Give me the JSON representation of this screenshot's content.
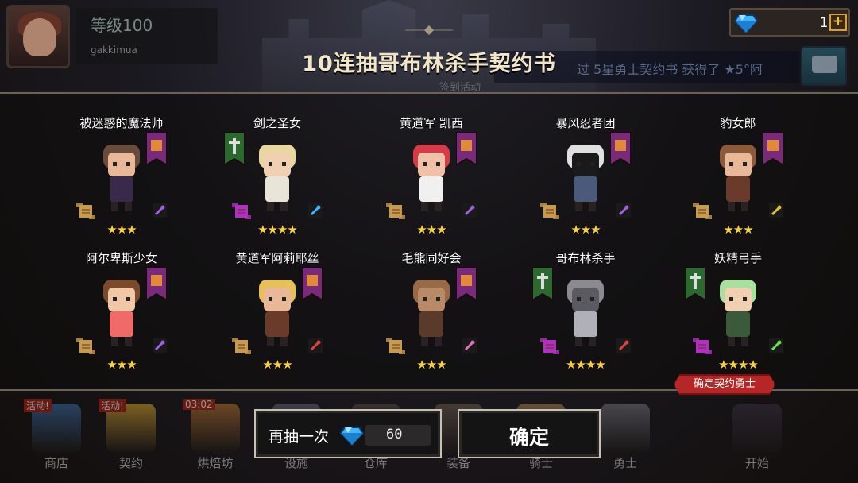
{
  "player": {
    "level": "等级100",
    "username": "gakkimua"
  },
  "currency": {
    "gems": "1"
  },
  "ticker": {
    "text": "过 5星勇士契约书 获得了 ★5°阿"
  },
  "modal": {
    "title": "10连抽哥布林杀手契约书",
    "sub_label": "签到活动",
    "redraw_label": "再抽一次",
    "redraw_cost": "60",
    "confirm_label": "确定",
    "confirm_tag": "确定契约勇士"
  },
  "heroes": [
    {
      "name": "被迷惑的魔法师",
      "stars": "★★★",
      "star_count": 3,
      "banner": "purple",
      "weapon": "staff-icon"
    },
    {
      "name": "剑之圣女",
      "stars": "★★★★",
      "star_count": 4,
      "banner": "green",
      "weapon": "hammer-icon"
    },
    {
      "name": "黄道军 凯西",
      "stars": "★★★",
      "star_count": 3,
      "banner": "purple",
      "weapon": "staff-icon"
    },
    {
      "name": "暴风忍者团",
      "stars": "★★★",
      "star_count": 3,
      "banner": "purple",
      "weapon": "staff-icon"
    },
    {
      "name": "豹女郎",
      "stars": "★★★",
      "star_count": 3,
      "banner": "purple",
      "weapon": "sword-icon"
    },
    {
      "name": "阿尔卑斯少女",
      "stars": "★★★",
      "star_count": 3,
      "banner": "purple",
      "weapon": "staff-icon"
    },
    {
      "name": "黄道军阿莉耶丝",
      "stars": "★★★",
      "star_count": 3,
      "banner": "purple",
      "weapon": "dagger-icon"
    },
    {
      "name": "毛熊同好会",
      "stars": "★★★",
      "star_count": 3,
      "banner": "purple",
      "weapon": "amulet-icon"
    },
    {
      "name": "哥布林杀手",
      "stars": "★★★★",
      "star_count": 4,
      "banner": "green",
      "weapon": "dagger-icon"
    },
    {
      "name": "妖精弓手",
      "stars": "★★★★",
      "star_count": 4,
      "banner": "green",
      "weapon": "bow-icon"
    }
  ],
  "nav": [
    {
      "label": "商店",
      "badge": "活动!"
    },
    {
      "label": "契约",
      "badge": "活动!"
    },
    {
      "label": "烘焙坊",
      "badge": "03:02"
    },
    {
      "label": "设施",
      "badge": ""
    },
    {
      "label": "仓库",
      "badge": ""
    },
    {
      "label": "装备",
      "badge": ""
    },
    {
      "label": "骑士",
      "badge": ""
    },
    {
      "label": "勇士",
      "badge": ""
    },
    {
      "label": "开始",
      "badge": ""
    }
  ],
  "colors": {
    "banner_purple": "#7a2a7a",
    "banner_green": "#2a6a2e",
    "star": "#ffd230",
    "gem": "#3fb4ff"
  }
}
